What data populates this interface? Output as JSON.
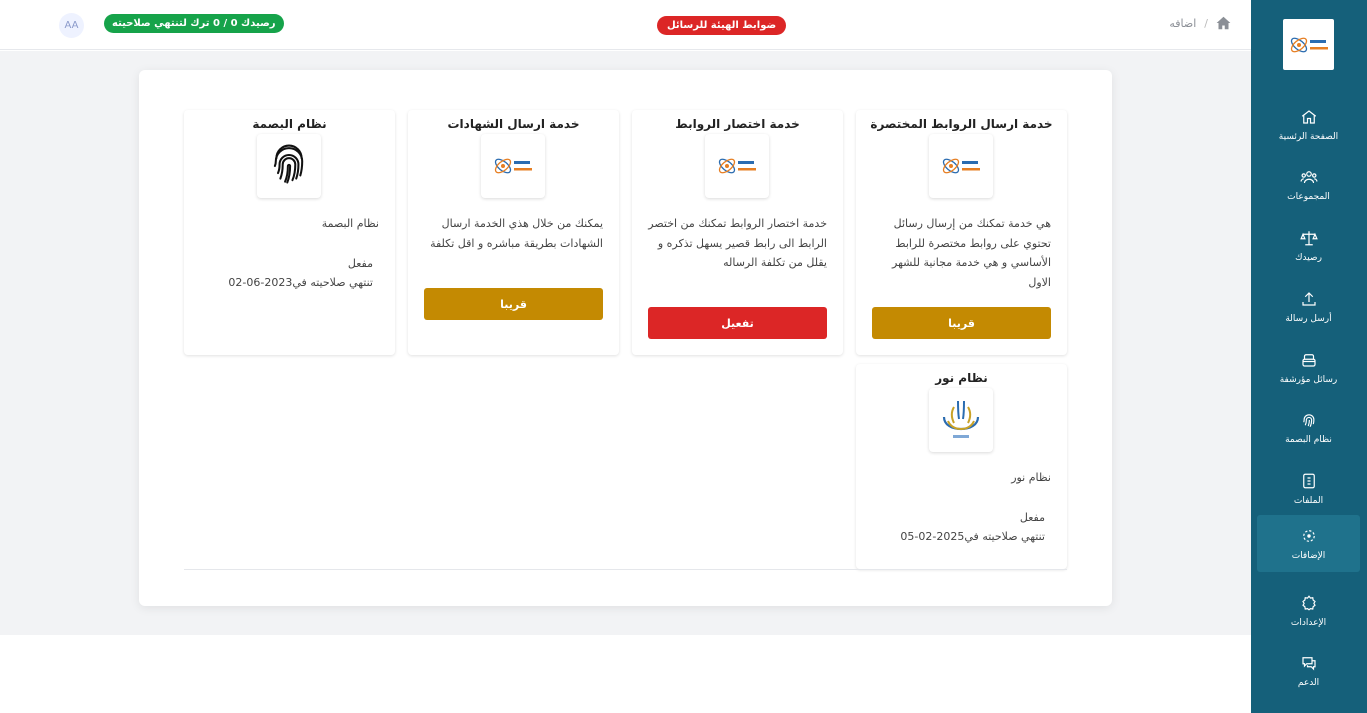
{
  "sidebar": {
    "items": [
      {
        "label": "الصفحة الرئسية",
        "icon": "home-icon"
      },
      {
        "label": "المجموعات",
        "icon": "groups-icon"
      },
      {
        "label": "رصيدك",
        "icon": "scale-icon"
      },
      {
        "label": "أرسل رسالة",
        "icon": "upload-icon"
      },
      {
        "label": "رسائل مؤرشفة",
        "icon": "archive-icon"
      },
      {
        "label": "نظام البصمة",
        "icon": "fingerprint-icon"
      },
      {
        "label": "الملفات",
        "icon": "files-icon"
      },
      {
        "label": "الإضافات",
        "icon": "addons-icon",
        "active": true
      },
      {
        "label": "الإعدادات",
        "icon": "settings-icon"
      },
      {
        "label": "الدعم",
        "icon": "support-icon"
      }
    ]
  },
  "header": {
    "breadcrumb": "اضافه",
    "regulations_badge": "ضوابط الهيئة للرسائل",
    "balance_badge": "رصيدك 0 / 0 ترك لتنتهي صلاحيته",
    "avatar": "AA"
  },
  "services": [
    {
      "title": "خدمة ارسال الروابط المختصرة",
      "desc": "هي خدمة تمكنك من إرسال رسائل تحتوي على روابط مختصرة للرابط الأساسي و هي خدمة مجانية للشهر الاول",
      "button": "قريبا"
    },
    {
      "title": "خدمة اختصار الروابط",
      "desc": "خدمة اختصار الروابط تمكنك من اختصر الرابط الى رابط قصير يسهل تذكره و يقلل من تكلفة الرساله",
      "button": "تفعيل"
    },
    {
      "title": "خدمة ارسال الشهادات",
      "desc": "يمكنك من خلال هذي الخدمة ارسال الشهادات بطريقة مباشره و اقل تكلفة",
      "button": "قريبا"
    },
    {
      "title": "نظام البصمة",
      "desc": "نظام البصمة",
      "status": "مفعل",
      "expiry_prefix": "تنتهي صلاحيته في",
      "expiry_date": "2023-06-02"
    },
    {
      "title": "نظام نور",
      "desc": "نظام نور",
      "status": "مفعل",
      "expiry_prefix": "تنتهي صلاحيته في",
      "expiry_date": "2025-02-05"
    }
  ],
  "colors": {
    "sidebar": "#15607a",
    "gold": "#c48a02",
    "red": "#dc2626",
    "green": "#16a34a"
  }
}
